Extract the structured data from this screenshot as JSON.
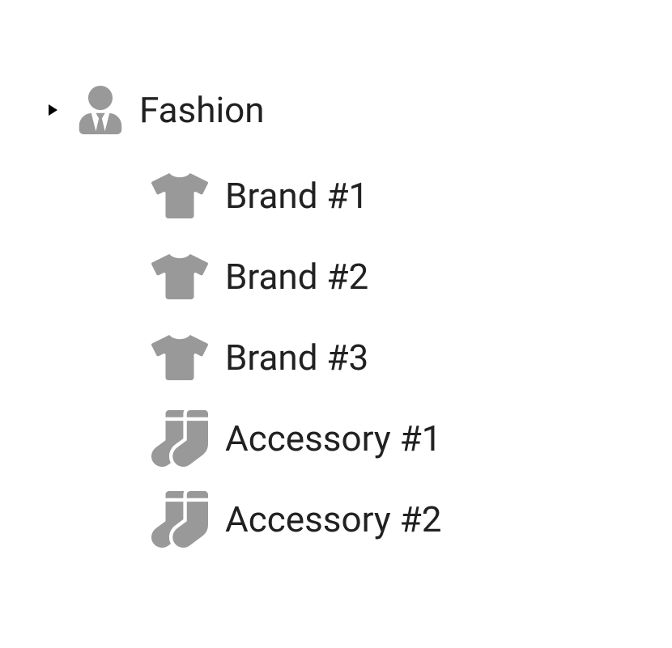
{
  "tree": {
    "root": {
      "label": "Fashion",
      "expanded": true,
      "icon": "user-tie-icon",
      "children": [
        {
          "label": "Brand #1",
          "icon": "tshirt-icon"
        },
        {
          "label": "Brand #2",
          "icon": "tshirt-icon"
        },
        {
          "label": "Brand #3",
          "icon": "tshirt-icon"
        },
        {
          "label": "Accessory #1",
          "icon": "socks-icon"
        },
        {
          "label": "Accessory #2",
          "icon": "socks-icon"
        }
      ]
    }
  },
  "colors": {
    "icon": "#999999",
    "text": "#212121",
    "arrow": "#000000"
  }
}
